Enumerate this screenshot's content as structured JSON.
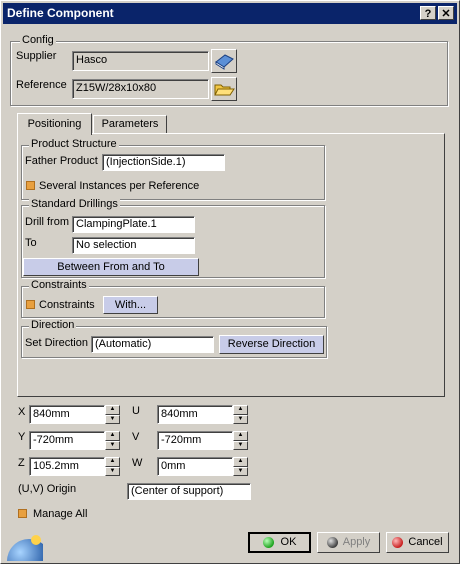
{
  "window": {
    "title": "Define Component",
    "help": "?",
    "close": "✕"
  },
  "config": {
    "label": "Config",
    "supplier_label": "Supplier",
    "supplier_value": "Hasco",
    "reference_label": "Reference",
    "reference_value": "Z15W/28x10x80"
  },
  "tabs": [
    {
      "label": "Positioning"
    },
    {
      "label": "Parameters"
    }
  ],
  "product_structure": {
    "label": "Product Structure",
    "father_label": "Father Product",
    "father_value": "(InjectionSide.1)",
    "instances_label": "Several Instances per Reference"
  },
  "drillings": {
    "label": "Standard Drillings",
    "from_label": "Drill from",
    "from_value": "ClampingPlate.1",
    "to_label": "To",
    "to_value": "No selection",
    "between_button": "Between From and To"
  },
  "constraints": {
    "label": "Constraints",
    "check_label": "Constraints",
    "with_button": "With..."
  },
  "direction": {
    "label": "Direction",
    "set_label": "Set Direction",
    "value": "(Automatic)",
    "reverse_button": "Reverse Direction"
  },
  "coords": {
    "x_label": "X",
    "x_value": "840mm",
    "y_label": "Y",
    "y_value": "-720mm",
    "z_label": "Z",
    "z_value": "105.2mm",
    "u_label": "U",
    "u_value": "840mm",
    "v_label": "V",
    "v_value": "-720mm",
    "w_label": "W",
    "w_value": "0mm",
    "origin_label": "(U,V) Origin",
    "origin_value": "(Center of support)"
  },
  "manage_all": "Manage All",
  "buttons": {
    "ok": "OK",
    "apply": "Apply",
    "cancel": "Cancel"
  }
}
